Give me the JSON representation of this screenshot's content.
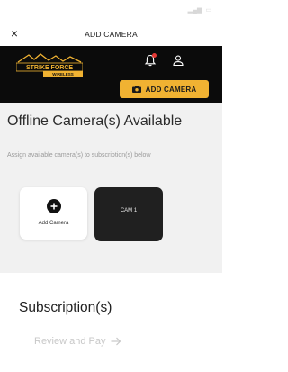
{
  "title_bar": {
    "close_symbol": "×",
    "title": "ADD CAMERA"
  },
  "header": {
    "brand": {
      "line1": "STRIKE FORCE",
      "line2": "WIRELESS",
      "accent_color": "#f0b232"
    },
    "icons": {
      "notifications": "bell-icon",
      "account": "user-icon"
    },
    "add_camera_button": {
      "label": "ADD CAMERA",
      "icon": "camera-icon",
      "color": "#f0b232"
    }
  },
  "offline": {
    "heading": "Offline Camera(s) Available",
    "subtext": "Assign available camera(s) to subscription(s) below",
    "tiles": [
      {
        "label": "Add Camera",
        "icon": "plus-icon"
      },
      {
        "label": "CAM 1"
      }
    ]
  },
  "subscriptions": {
    "heading": "Subscription(s)",
    "review_link": "Review and Pay",
    "review_icon": "arrow-right-icon"
  }
}
